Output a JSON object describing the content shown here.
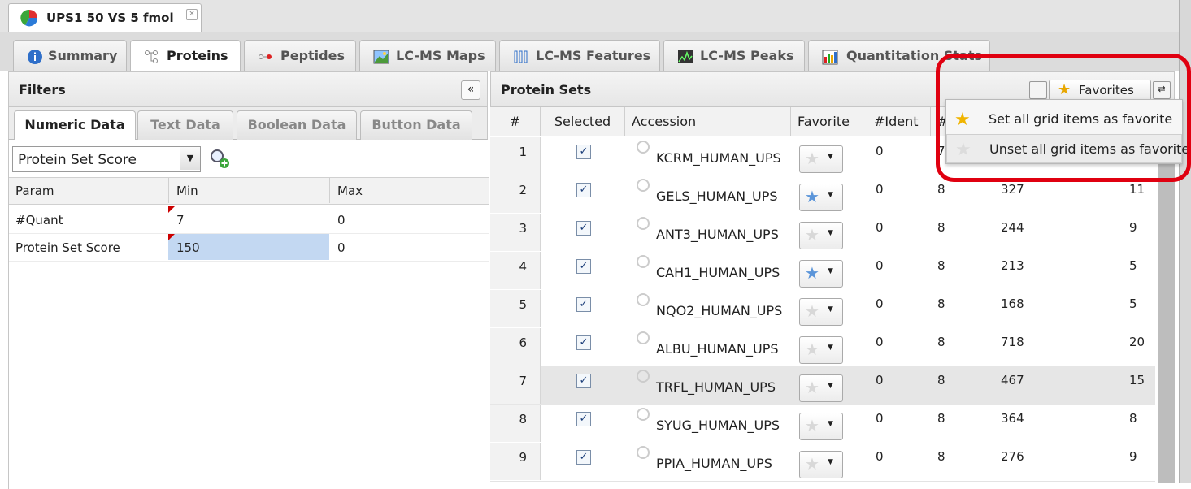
{
  "doc_tab": {
    "title": "UPS1 50 VS 5 fmol",
    "close": "×"
  },
  "main_tabs": [
    {
      "label": "Summary",
      "icon": "info-icon"
    },
    {
      "label": "Proteins",
      "icon": "tree-icon"
    },
    {
      "label": "Peptides",
      "icon": "peptide-icon"
    },
    {
      "label": "LC-MS Maps",
      "icon": "map-icon"
    },
    {
      "label": "LC-MS Features",
      "icon": "features-icon"
    },
    {
      "label": "LC-MS Peaks",
      "icon": "peaks-icon"
    },
    {
      "label": "Quantitation Stats",
      "icon": "bar-chart-icon"
    }
  ],
  "filters": {
    "title": "Filters",
    "collapse": "«",
    "tabs": [
      "Numeric Data",
      "Text Data",
      "Boolean Data",
      "Button Data"
    ],
    "param_select": "Protein Set Score",
    "columns": [
      "Param",
      "Min",
      "Max"
    ],
    "rows": [
      {
        "param": "#Quant",
        "min": "7",
        "max": "0"
      },
      {
        "param": "Protein Set Score",
        "min": "150",
        "max": "0"
      }
    ]
  },
  "protein_sets": {
    "title": "Protein Sets",
    "favorites_label": "Favorites",
    "columns": [
      "#",
      "Selected",
      "Accession",
      "Favorite",
      "#Ident",
      "#"
    ],
    "rows": [
      {
        "n": "1",
        "acc": "KCRM_HUMAN_UPS",
        "fav": false,
        "ident": "0",
        "c2": "7",
        "c3": "",
        "c4": ""
      },
      {
        "n": "2",
        "acc": "GELS_HUMAN_UPS",
        "fav": true,
        "ident": "0",
        "c2": "8",
        "c3": "327",
        "c4": "11"
      },
      {
        "n": "3",
        "acc": "ANT3_HUMAN_UPS",
        "fav": false,
        "ident": "0",
        "c2": "8",
        "c3": "244",
        "c4": "9"
      },
      {
        "n": "4",
        "acc": "CAH1_HUMAN_UPS",
        "fav": true,
        "ident": "0",
        "c2": "8",
        "c3": "213",
        "c4": "5"
      },
      {
        "n": "5",
        "acc": "NQO2_HUMAN_UPS",
        "fav": false,
        "ident": "0",
        "c2": "8",
        "c3": "168",
        "c4": "5"
      },
      {
        "n": "6",
        "acc": "ALBU_HUMAN_UPS",
        "fav": false,
        "ident": "0",
        "c2": "8",
        "c3": "718",
        "c4": "20"
      },
      {
        "n": "7",
        "acc": "TRFL_HUMAN_UPS",
        "fav": false,
        "ident": "0",
        "c2": "8",
        "c3": "467",
        "c4": "15"
      },
      {
        "n": "8",
        "acc": "SYUG_HUMAN_UPS",
        "fav": false,
        "ident": "0",
        "c2": "8",
        "c3": "364",
        "c4": "8"
      },
      {
        "n": "9",
        "acc": "PPIA_HUMAN_UPS",
        "fav": false,
        "ident": "0",
        "c2": "8",
        "c3": "276",
        "c4": "9"
      }
    ]
  },
  "favorites_menu": {
    "items": [
      {
        "label": "Set all grid items as favorite",
        "icon": "star-filled-icon"
      },
      {
        "label": "Unset all grid items as favorite",
        "icon": "star-empty-icon"
      }
    ]
  },
  "colors": {
    "highlight": "#e00010",
    "fav_on": "#5b95d9",
    "star_gold": "#e8a700"
  }
}
